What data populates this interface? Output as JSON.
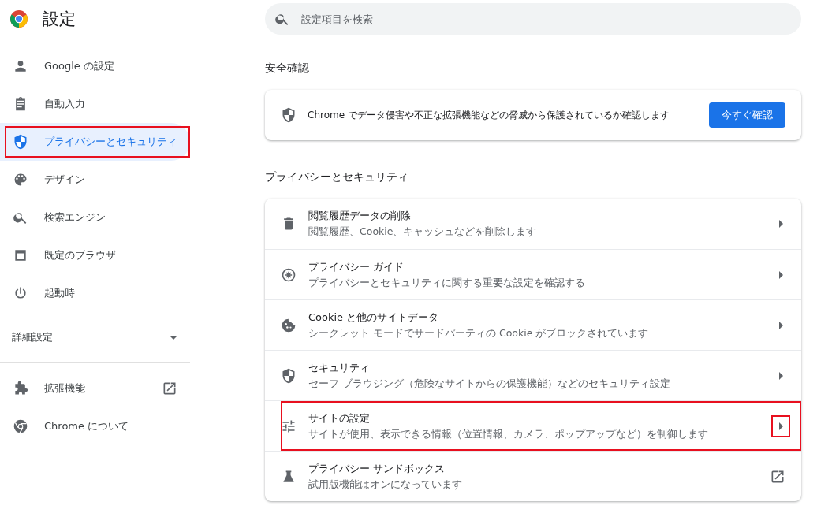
{
  "header": {
    "title": "設定"
  },
  "search": {
    "placeholder": "設定項目を検索"
  },
  "sidebar": {
    "items": [
      {
        "label": "Google の設定",
        "selected": false,
        "highlighted": false
      },
      {
        "label": "自動入力",
        "selected": false,
        "highlighted": false
      },
      {
        "label": "プライバシーとセキュリティ",
        "selected": true,
        "highlighted": true
      },
      {
        "label": "デザイン",
        "selected": false,
        "highlighted": false
      },
      {
        "label": "検索エンジン",
        "selected": false,
        "highlighted": false
      },
      {
        "label": "既定のブラウザ",
        "selected": false,
        "highlighted": false
      },
      {
        "label": "起動時",
        "selected": false,
        "highlighted": false
      }
    ],
    "advanced": {
      "label": "詳細設定",
      "expanded": false
    },
    "footer_items": [
      {
        "label": "拡張機能",
        "kind": "external"
      },
      {
        "label": "Chrome について",
        "kind": "link"
      }
    ]
  },
  "safety_check": {
    "heading": "安全確認",
    "text": "Chrome でデータ侵害や不正な拡張機能などの脅威から保護されているか確認します",
    "button": "今すぐ確認"
  },
  "privacy": {
    "heading": "プライバシーとセキュリティ",
    "rows": [
      {
        "title": "閲覧履歴データの削除",
        "subtitle": "閲覧履歴、Cookie、キャッシュなどを削除します",
        "kind": "arrow",
        "highlighted": false
      },
      {
        "title": "プライバシー ガイド",
        "subtitle": "プライバシーとセキュリティに関する重要な設定を確認する",
        "kind": "arrow",
        "highlighted": false
      },
      {
        "title": "Cookie と他のサイトデータ",
        "subtitle": "シークレット モードでサードパーティの Cookie がブロックされています",
        "kind": "arrow",
        "highlighted": false
      },
      {
        "title": "セキュリティ",
        "subtitle": "セーフ ブラウジング（危険なサイトからの保護機能）などのセキュリティ設定",
        "kind": "arrow",
        "highlighted": false
      },
      {
        "title": "サイトの設定",
        "subtitle": "サイトが使用、表示できる情報（位置情報、カメラ、ポップアップなど）を制御します",
        "kind": "arrow",
        "highlighted": true
      },
      {
        "title": "プライバシー サンドボックス",
        "subtitle": "試用版機能はオンになっています",
        "kind": "external",
        "highlighted": false
      }
    ]
  }
}
